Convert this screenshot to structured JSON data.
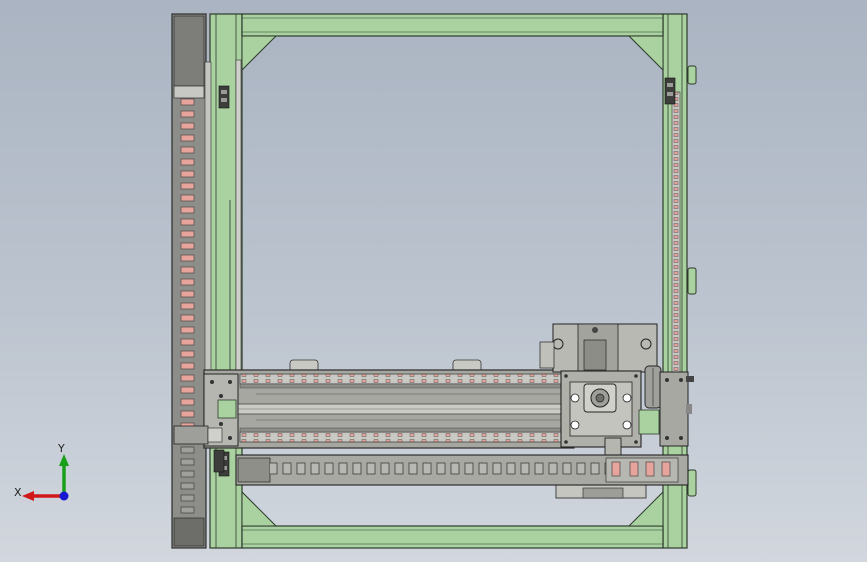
{
  "viewport": {
    "background_top": "#aab4c2",
    "background_bottom": "#d2d7de"
  },
  "model": {
    "frame_color": "#a9d2a0",
    "frame_stroke": "#2e3b2c",
    "metal_color": "#b3b3ad",
    "dark_metal_color": "#6f6f6a",
    "chain_pad_color": "#e7a49c"
  },
  "triad": {
    "x_label": "X",
    "y_label": "Y",
    "x_color": "#d01818",
    "y_color": "#18a018",
    "z_color": "#1818d0",
    "icon": "coordinate-triad-icon"
  }
}
